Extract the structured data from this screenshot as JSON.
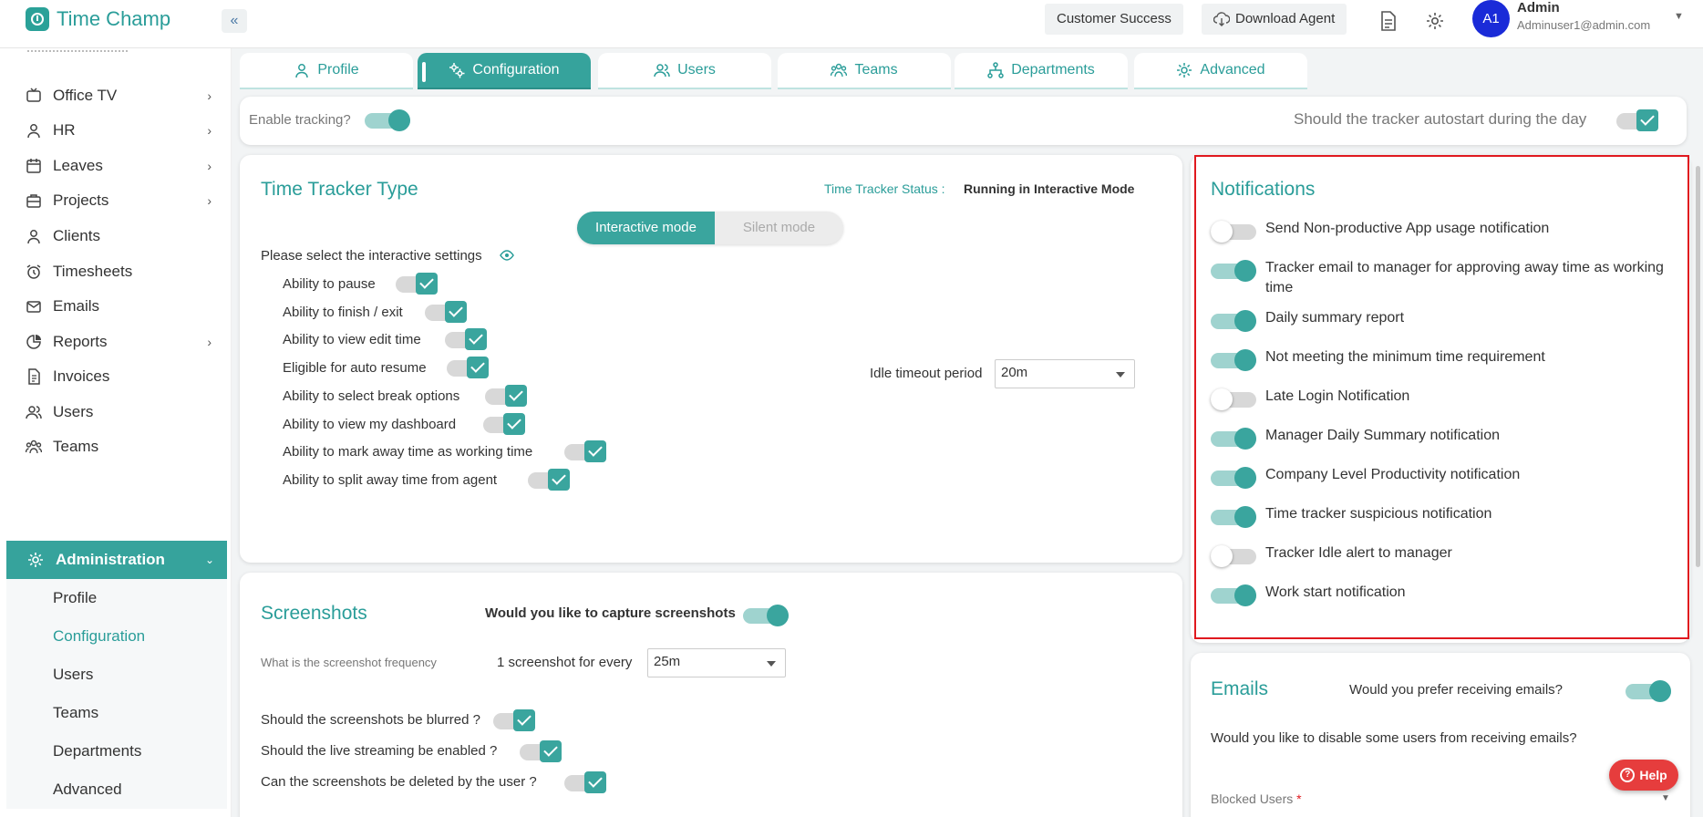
{
  "app": {
    "name": "Time Champ"
  },
  "header": {
    "customer_success": "Customer Success",
    "download_agent": "Download Agent",
    "avatar_initials": "A1",
    "user_name": "Admin",
    "user_email": "Adminuser1@admin.com"
  },
  "sidebar": {
    "items": [
      {
        "label": "Office TV",
        "icon": "tv-icon",
        "chevron": true
      },
      {
        "label": "HR",
        "icon": "person-icon",
        "chevron": true
      },
      {
        "label": "Leaves",
        "icon": "calendar-icon",
        "chevron": true
      },
      {
        "label": "Projects",
        "icon": "briefcase-icon",
        "chevron": true
      },
      {
        "label": "Clients",
        "icon": "person-icon",
        "chevron": false
      },
      {
        "label": "Timesheets",
        "icon": "alarm-icon",
        "chevron": false
      },
      {
        "label": "Emails",
        "icon": "mail-icon",
        "chevron": false
      },
      {
        "label": "Reports",
        "icon": "pie-chart-icon",
        "chevron": true
      },
      {
        "label": "Invoices",
        "icon": "document-icon",
        "chevron": false
      },
      {
        "label": "Users",
        "icon": "users-icon",
        "chevron": false
      },
      {
        "label": "Teams",
        "icon": "team-icon",
        "chevron": false
      }
    ],
    "active": "Administration",
    "subitems": [
      "Profile",
      "Configuration",
      "Users",
      "Teams",
      "Departments",
      "Advanced"
    ],
    "current_sub": "Configuration"
  },
  "tabs": [
    {
      "label": "Profile",
      "icon": "person-icon"
    },
    {
      "label": "Configuration",
      "icon": "gears-icon",
      "active": true
    },
    {
      "label": "Users",
      "icon": "users-icon"
    },
    {
      "label": "Teams",
      "icon": "team-icon"
    },
    {
      "label": "Departments",
      "icon": "hierarchy-icon"
    },
    {
      "label": "Advanced",
      "icon": "gear-icon"
    }
  ],
  "tracking": {
    "enable_label": "Enable tracking?",
    "enable_on": true,
    "autostart_label": "Should the tracker autostart during the day",
    "autostart_checked": true
  },
  "tracker_type": {
    "title": "Time Tracker Type",
    "status_label": "Time Tracker Status :",
    "status_value": "Running in Interactive Mode",
    "mode_interactive": "Interactive mode",
    "mode_silent": "Silent mode",
    "selected_mode": "Interactive mode",
    "settings_prompt": "Please select the interactive settings",
    "settings": [
      {
        "label": "Ability to pause",
        "checked": true
      },
      {
        "label": "Ability to finish / exit",
        "checked": true
      },
      {
        "label": "Ability to view edit time",
        "checked": true
      },
      {
        "label": "Eligible for auto resume",
        "checked": true
      },
      {
        "label": "Ability to select break options",
        "checked": true
      },
      {
        "label": "Ability to view my dashboard",
        "checked": true
      },
      {
        "label": "Ability to mark away time as working time",
        "checked": true
      },
      {
        "label": "Ability to split away time from agent",
        "checked": true
      }
    ],
    "idle_label": "Idle timeout period",
    "idle_value": "20m"
  },
  "screenshots": {
    "title": "Screenshots",
    "capture_label": "Would you like to capture screenshots",
    "capture_on": true,
    "frequency_label": "What is the screenshot frequency",
    "every_label": "1 screenshot for every",
    "frequency_value": "25m",
    "blurred_label": "Should the screenshots be blurred ?",
    "streaming_label": "Should the live streaming be enabled ?",
    "deleted_label": "Can the screenshots be deleted by the user ?"
  },
  "notifications": {
    "title": "Notifications",
    "items": [
      {
        "label": "Send Non-productive App usage notification",
        "on": false
      },
      {
        "label": "Tracker email to manager for approving away time as working time",
        "on": true
      },
      {
        "label": "Daily summary report",
        "on": true
      },
      {
        "label": "Not meeting the minimum time requirement",
        "on": true
      },
      {
        "label": "Late Login Notification",
        "on": false
      },
      {
        "label": "Manager Daily Summary notification",
        "on": true
      },
      {
        "label": "Company Level Productivity notification",
        "on": true
      },
      {
        "label": "Time tracker suspicious notification",
        "on": true
      },
      {
        "label": "Tracker Idle alert to manager",
        "on": false
      },
      {
        "label": "Work start notification",
        "on": true
      }
    ]
  },
  "emails": {
    "title": "Emails",
    "receive_label": "Would you prefer receiving emails?",
    "receive_on": true,
    "disable_label": "Would you like to disable some users from receiving emails?",
    "blocked_label": "Blocked Users",
    "required_mark": "*"
  },
  "help": {
    "label": "Help"
  },
  "colors": {
    "accent": "#36a39c",
    "brand": "#2a9d99",
    "highlight": "#e0191f",
    "avatar": "#1a2bd8",
    "help": "#e63d3d"
  }
}
